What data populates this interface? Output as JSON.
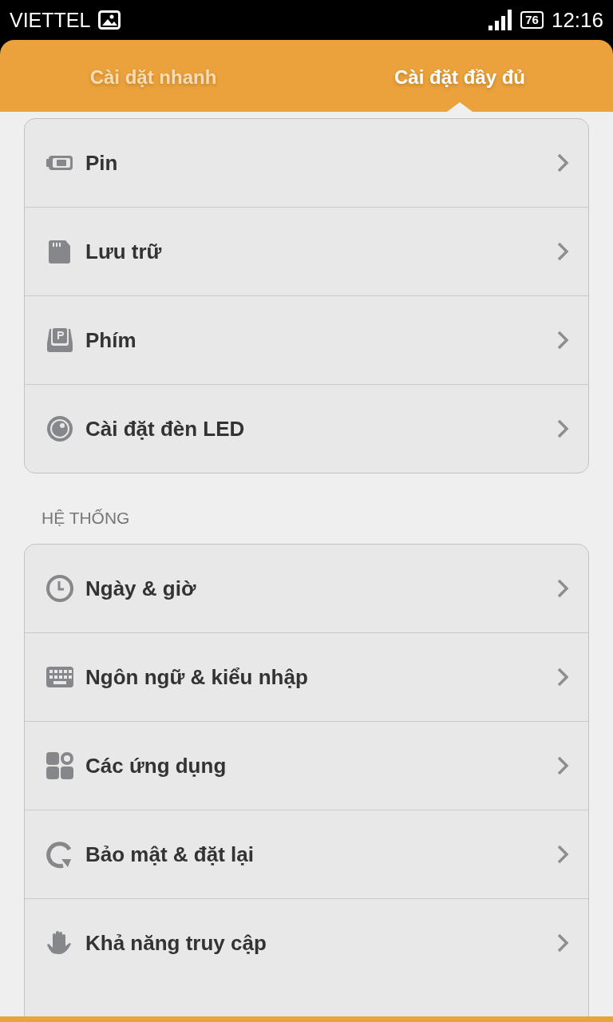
{
  "status_bar": {
    "carrier": "VIETTEL",
    "battery": "76",
    "time": "12:16"
  },
  "tabs": [
    {
      "label": "Cài dặt nhanh",
      "selected": false
    },
    {
      "label": "Cài đặt đầy đủ",
      "selected": true
    }
  ],
  "groups": [
    {
      "items": [
        {
          "label": "Pin"
        },
        {
          "label": "Lưu trữ"
        },
        {
          "label": "Phím"
        },
        {
          "label": "Cài đặt đèn LED"
        }
      ]
    },
    {
      "title": "HỆ THỐNG",
      "items": [
        {
          "label": "Ngày & giờ"
        },
        {
          "label": "Ngôn ngữ & kiểu nhập"
        },
        {
          "label": "Các ứng dụng"
        },
        {
          "label": "Bảo mật & đặt lại"
        },
        {
          "label": "Khả năng truy cập"
        }
      ]
    }
  ]
}
